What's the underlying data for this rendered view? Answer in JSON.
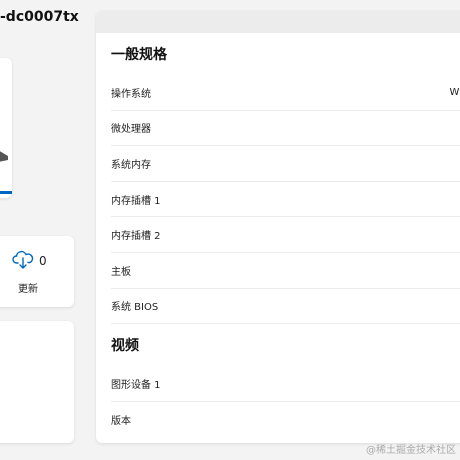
{
  "page": {
    "title": "-dc0007tx"
  },
  "update": {
    "count": "0",
    "label": "更新"
  },
  "general_specs": {
    "title": "一般规格",
    "rows": [
      {
        "label": "操作系统",
        "value": "Wi"
      },
      {
        "label": "微处理器",
        "value": ""
      },
      {
        "label": "系统内存",
        "value": ""
      },
      {
        "label": "内存插槽 1",
        "value": ""
      },
      {
        "label": "内存插槽 2",
        "value": ""
      },
      {
        "label": "主板",
        "value": ""
      },
      {
        "label": "系统 BIOS",
        "value": ""
      }
    ]
  },
  "video_specs": {
    "title": "视频",
    "rows": [
      {
        "label": "图形设备 1"
      },
      {
        "label": "版本"
      }
    ]
  },
  "watermark": "@稀土掘金技术社区",
  "colors": {
    "accent": "#0067c0",
    "background": "#f3f3f3",
    "card": "#ffffff"
  }
}
